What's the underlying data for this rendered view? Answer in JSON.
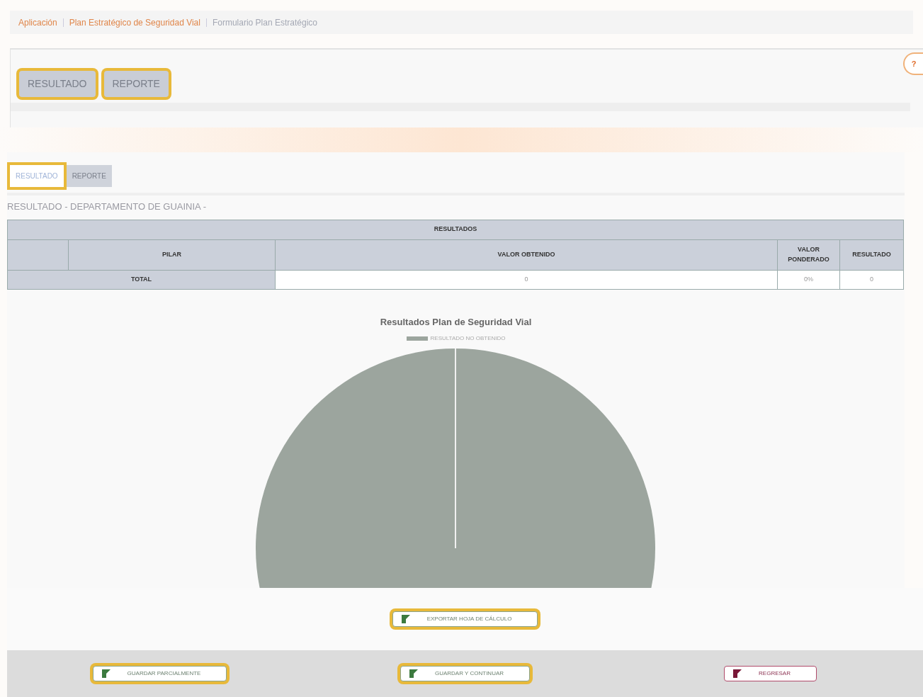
{
  "breadcrumb": [
    {
      "label": "Aplicación",
      "kind": "link"
    },
    {
      "label": "Plan Estratégico de Seguridad Vial",
      "kind": "link"
    },
    {
      "label": "Formulario Plan Estratégico",
      "kind": "current"
    }
  ],
  "top_panel": {
    "buttons": [
      {
        "label": "RESULTADO",
        "highlighted": true
      },
      {
        "label": "REPORTE",
        "highlighted": true
      }
    ],
    "help_icon": "?"
  },
  "tabs": [
    {
      "label": "RESULTADO",
      "selected": true,
      "highlighted": true
    },
    {
      "label": "REPORTE",
      "selected": false,
      "highlighted": false
    }
  ],
  "section_title": "RESULTADO - DEPARTAMENTO DE GUAINIA -",
  "table": {
    "caption": "RESULTADOS",
    "columns": [
      "PILAR",
      "VALOR OBTENIDO",
      "VALOR PONDERADO",
      "RESULTADO"
    ],
    "total_row": {
      "label": "TOTAL",
      "cells": [
        "0",
        "0%",
        "0"
      ]
    }
  },
  "chart": {
    "title": "Resultados Plan de Seguridad Vial",
    "legend": [
      {
        "label": "RESULTADO NO OBTENIDO",
        "color": "#9ca59e"
      }
    ]
  },
  "export_button": {
    "label": "EXPORTAR HOJA DE CÁLCULO",
    "highlighted": true,
    "kind": "excel"
  },
  "footer_buttons": [
    {
      "label": "GUARDAR PARCIALMENTE",
      "highlighted": true,
      "kind": "save"
    },
    {
      "label": "GUARDAR Y CONTINUAR",
      "highlighted": true,
      "kind": "save"
    },
    {
      "label": "REGRESAR",
      "highlighted": false,
      "kind": "back"
    }
  ]
}
